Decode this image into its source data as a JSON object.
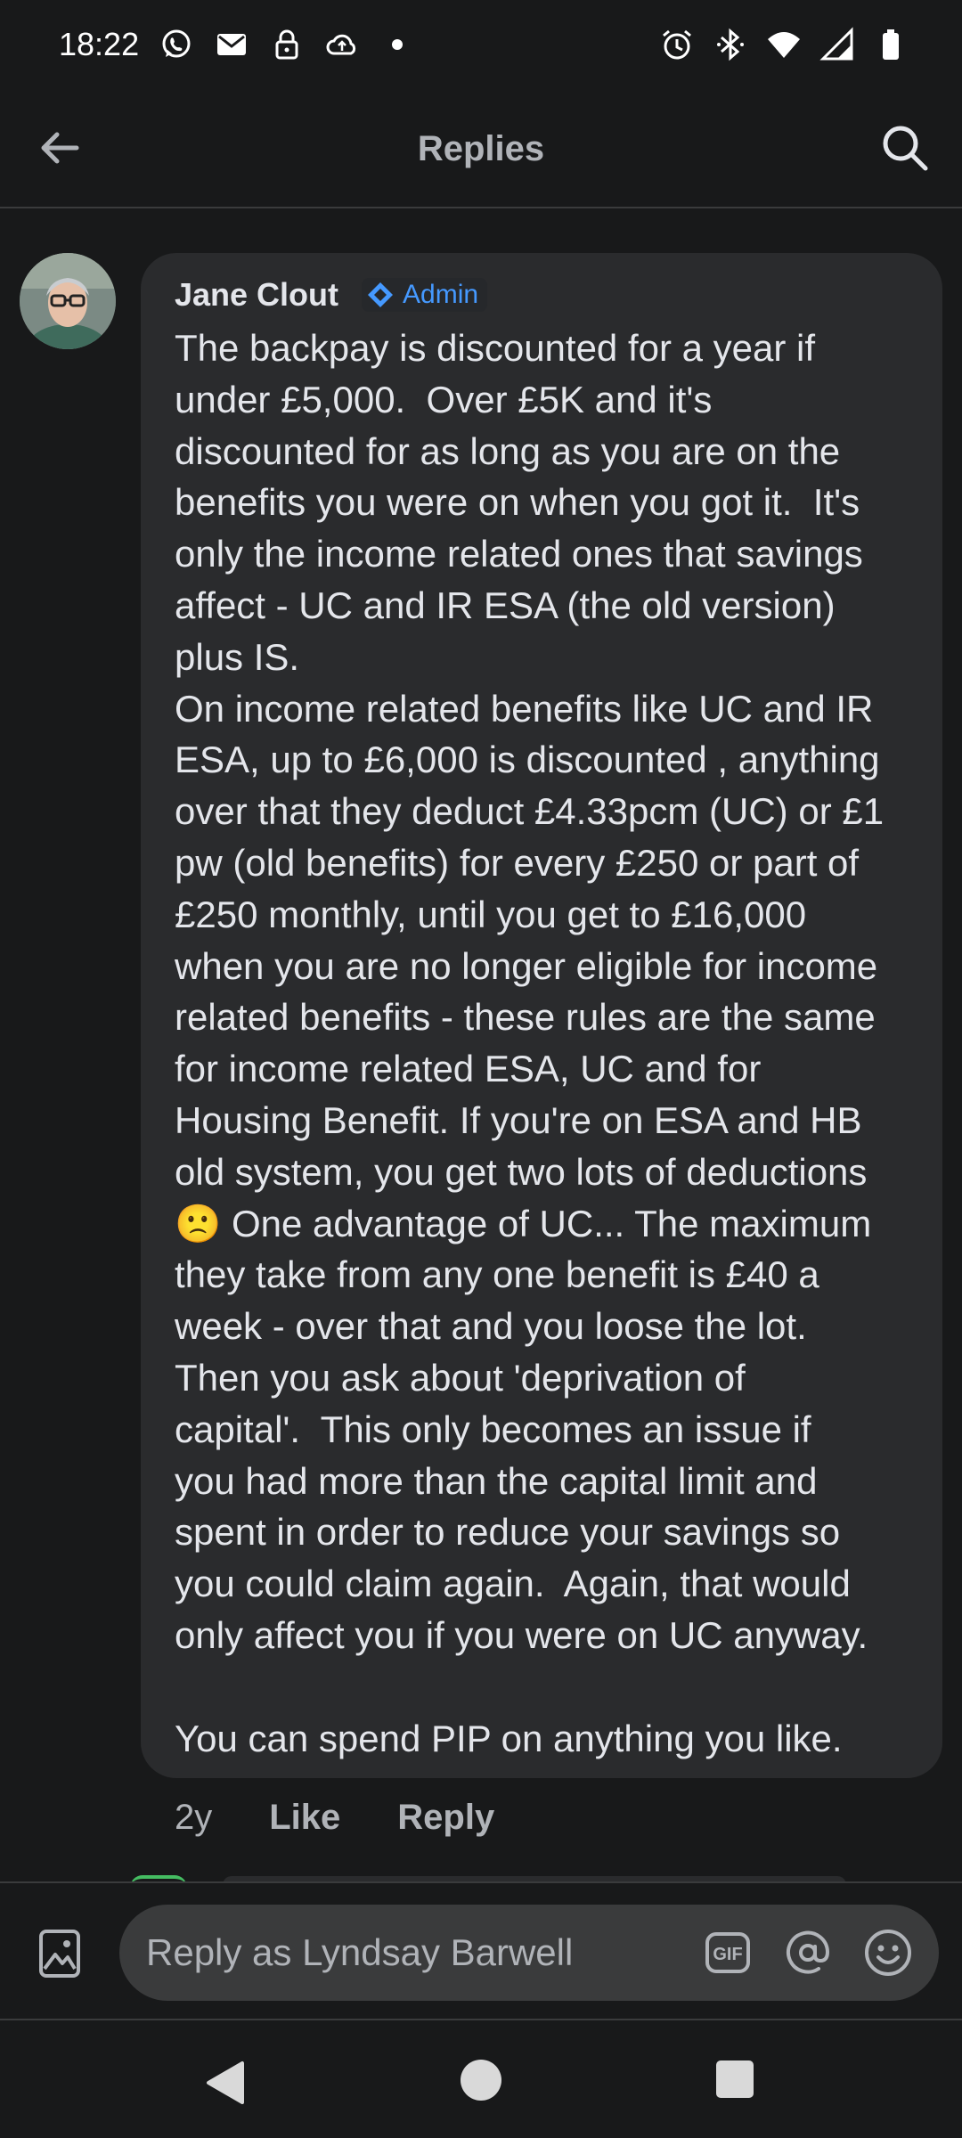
{
  "status_bar": {
    "time": "18:22",
    "left_icons": [
      "whatsapp-icon",
      "gmail-icon",
      "lock-icon",
      "cloud-upload-icon",
      "dot-icon"
    ],
    "right_icons": [
      "alarm-icon",
      "bluetooth-icon",
      "wifi-icon",
      "signal-icon",
      "battery-icon"
    ]
  },
  "header": {
    "title": "Replies",
    "back_icon": "arrow-left-icon",
    "search_icon": "search-icon"
  },
  "comment": {
    "author": "Jane Clout",
    "badge": "Admin",
    "body": "The backpay is discounted for a year if\nunder £5,000.  Over £5K and it's\ndiscounted for as long as you are on the\nbenefits you were on when you got it.  It's\nonly the income related ones that savings\naffect - UC and IR ESA (the old version)\nplus IS.\nOn income related benefits like UC and IR\nESA, up to £6,000 is discounted , anything\nover that they deduct £4.33pcm (UC) or £1\npw (old benefits) for every £250 or part of\n£250 monthly, until you get to £16,000\nwhen you are no longer eligible for income\nrelated benefits - these rules are the same\nfor income related ESA, UC and for\nHousing Benefit. If you're on ESA and HB\nold system, you get two lots of deductions\n🙁 One advantage of UC... The maximum\nthey take from any one benefit is £40 a\nweek - over that and you loose the lot.\nThen you ask about 'deprivation of\ncapital'.  This only becomes an issue if\nyou had more than the capital limit and\nspent in order to reduce your savings so\nyou could claim again.  Again, that would\nonly affect you if you were on UC anyway.\n\nYou can spend PIP on anything you like.",
    "time_ago": "2y",
    "like_label": "Like",
    "reply_label": "Reply"
  },
  "composer": {
    "placeholder": "Reply as Lyndsay Barwell",
    "icons": [
      "photo-icon",
      "gif-icon",
      "mention-icon",
      "emoji-icon"
    ]
  },
  "nav_bar": {
    "icons": [
      "nav-back-icon",
      "nav-home-icon",
      "nav-recents-icon"
    ]
  },
  "colors": {
    "background": "#18191a",
    "bubble": "#2a2b2d",
    "admin_blue": "#4599ff",
    "secondary_text": "#b0b3b8"
  }
}
